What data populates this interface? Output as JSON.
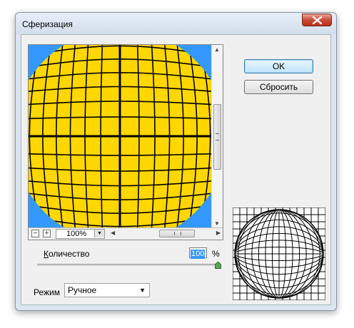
{
  "window": {
    "title": "Сферизация"
  },
  "preview": {
    "zoom_value": "100%",
    "zoom_out_symbol": "−",
    "zoom_in_symbol": "+",
    "background_color": "#3399ff",
    "sphere_color": "#ffd700",
    "grid_color": "#000000"
  },
  "buttons": {
    "ok": "OK",
    "reset": "Сбросить"
  },
  "amount": {
    "label_accel": "К",
    "label_rest": "оличество",
    "value": "100",
    "unit": "%",
    "slider_fraction": 1.0
  },
  "mode": {
    "label": "Режим",
    "selected": "Ручное"
  }
}
